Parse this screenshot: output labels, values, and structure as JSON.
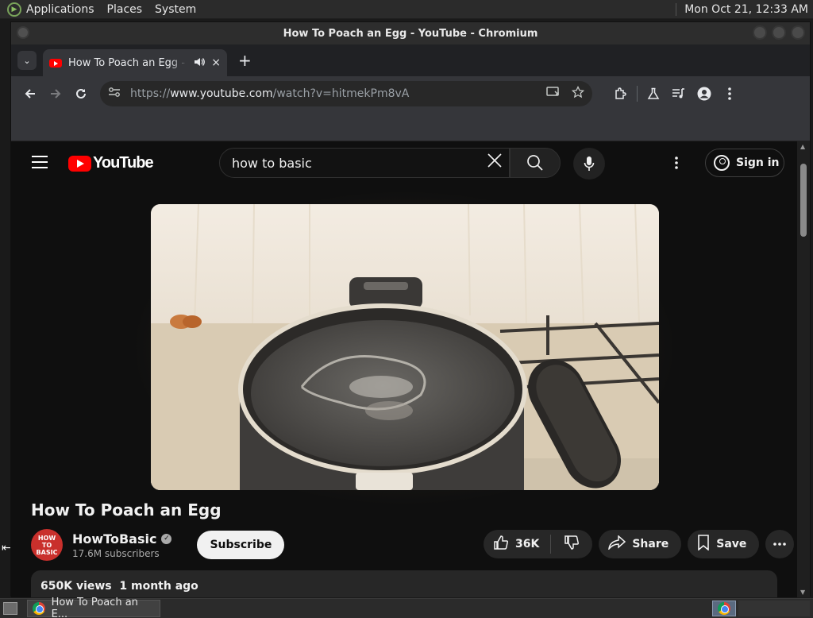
{
  "top_panel": {
    "menus": [
      "Applications",
      "Places",
      "System"
    ],
    "clock": "Mon Oct 21, 12:33 AM"
  },
  "window": {
    "title": "How To Poach an Egg - YouTube - Chromium"
  },
  "tab": {
    "title": "How To Poach an Egg - YouTube",
    "audio_icon": "speaker-icon",
    "close_glyph": "×",
    "new_tab_glyph": "+",
    "tab_list_glyph": "⌄"
  },
  "toolbar": {
    "url_scheme": "https://",
    "url_host": "www.youtube.com",
    "url_path": "/watch?v=hitmekPm8vA"
  },
  "youtube": {
    "search_value": "how to basic",
    "sign_in_label": "Sign in",
    "logo_text": "YouTube",
    "video_title": "How To Poach an Egg",
    "channel_name": "HowToBasic",
    "channel_avatar_text": "HOW TO BASIC",
    "subscribers": "17.6M subscribers",
    "subscribe_label": "Subscribe",
    "like_count": "36K",
    "share_label": "Share",
    "save_label": "Save",
    "description_meta": "650K views  1 month ago"
  },
  "taskbar": {
    "task_label": "How To Poach an E..."
  },
  "colors": {
    "yt_red": "#ff0000",
    "page_bg": "#0f0f0f",
    "chrome_toolbar": "#35363a"
  }
}
